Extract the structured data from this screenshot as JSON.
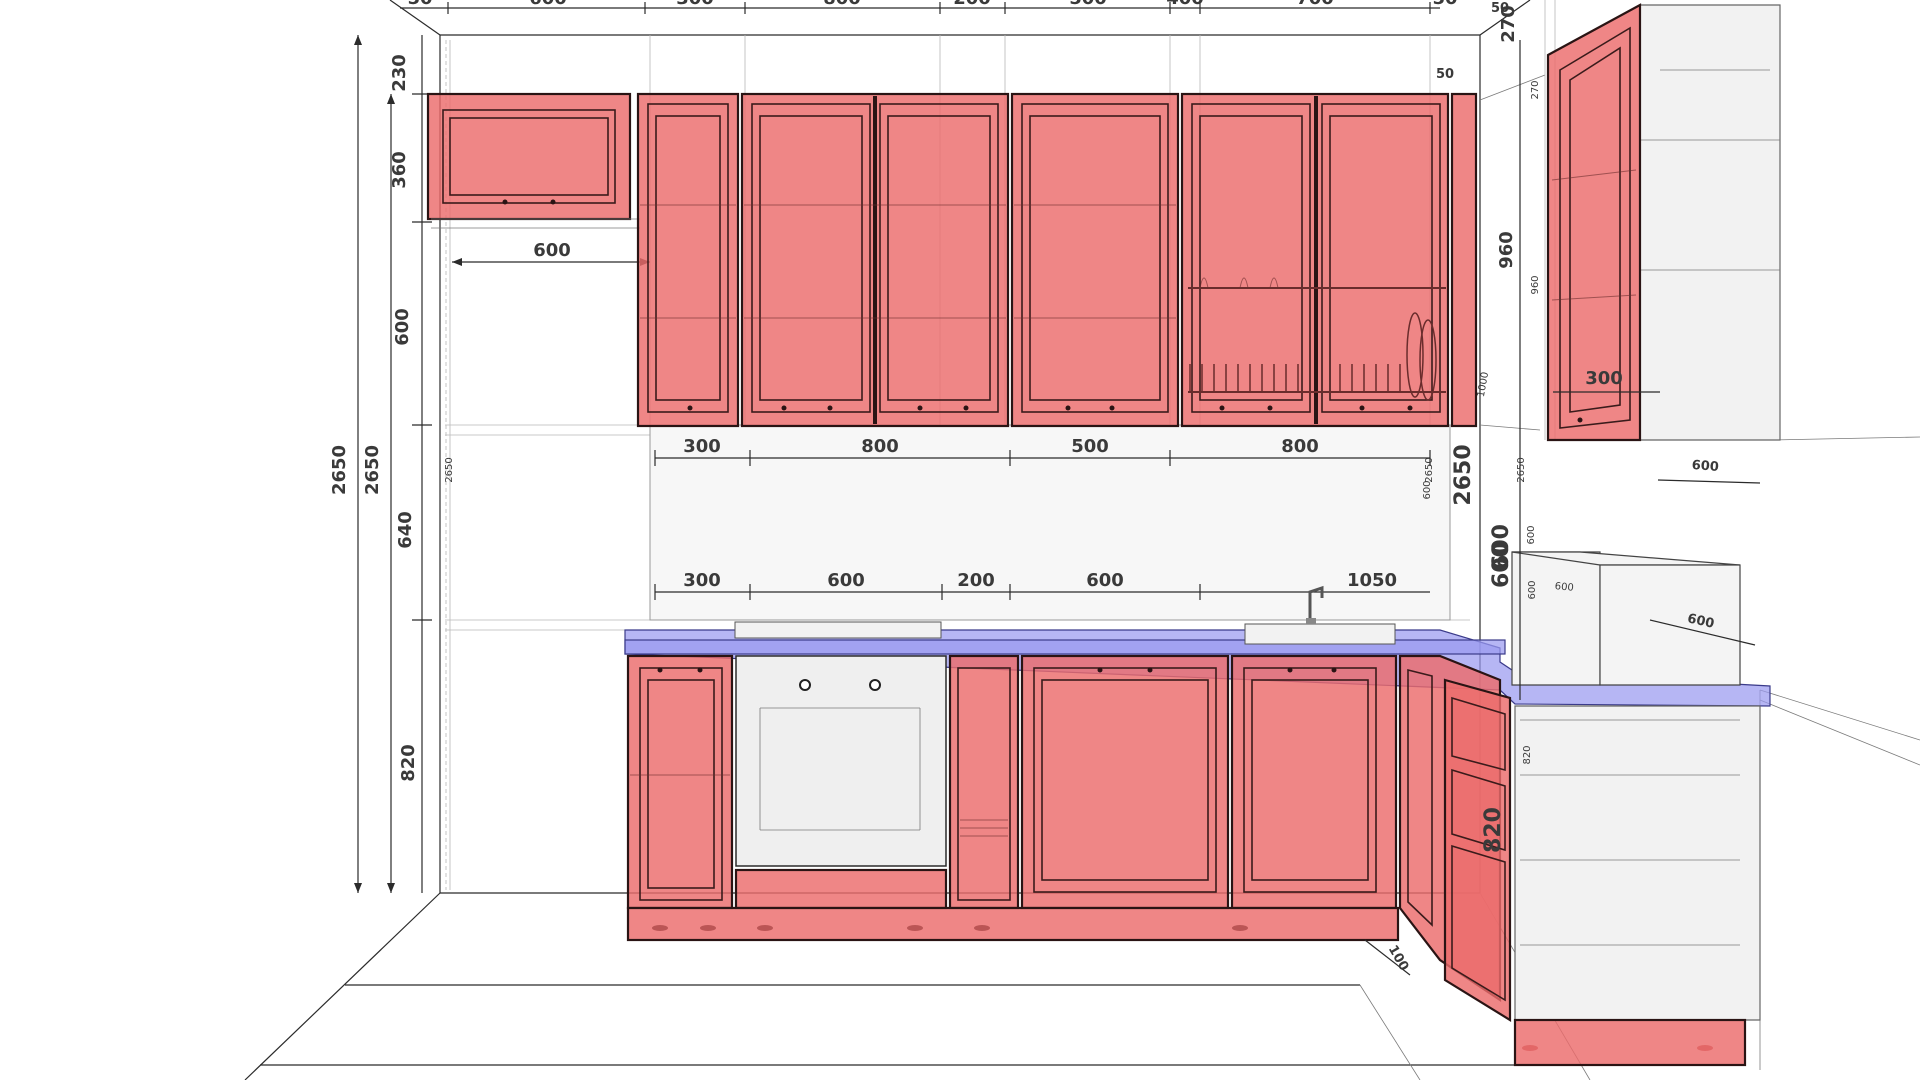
{
  "colors": {
    "cabinet": "#ec6b6b",
    "countertop": "#9a9af0",
    "appliance": "#efefef",
    "line": "#2b2b2b"
  },
  "dims": {
    "top_row": [
      "600",
      "300",
      "800",
      "200",
      "500",
      "400",
      "700",
      "50",
      "50",
      "50",
      "270"
    ],
    "h_2650_a": "2650",
    "h_2650_b": "2650",
    "h_2650_c": "2650",
    "h_2650_d": "2650",
    "h_230": "230",
    "h_360": "360",
    "h_600": "600",
    "h_640": "640",
    "h_820": "820",
    "h_50": "50",
    "h_960": "960",
    "h_960_sm": "960",
    "h_270": "270",
    "h_1000": "1000",
    "h_600_wall": "600",
    "h_600_r": "600",
    "h_600_r2": "600",
    "h_600_big": "600",
    "h_600_big2": "600",
    "h_820_r": "820",
    "h_820_big": "820",
    "w_600_hood": "600",
    "upper": [
      "300",
      "800",
      "500",
      "800"
    ],
    "lower": [
      "300",
      "600",
      "200",
      "600",
      "1050"
    ],
    "w_300_tall": "300",
    "w_600_r1": "600",
    "w_600_r2": "600",
    "w_600_r3": "600",
    "w_600_r4": "600",
    "plinth_100": "100"
  }
}
